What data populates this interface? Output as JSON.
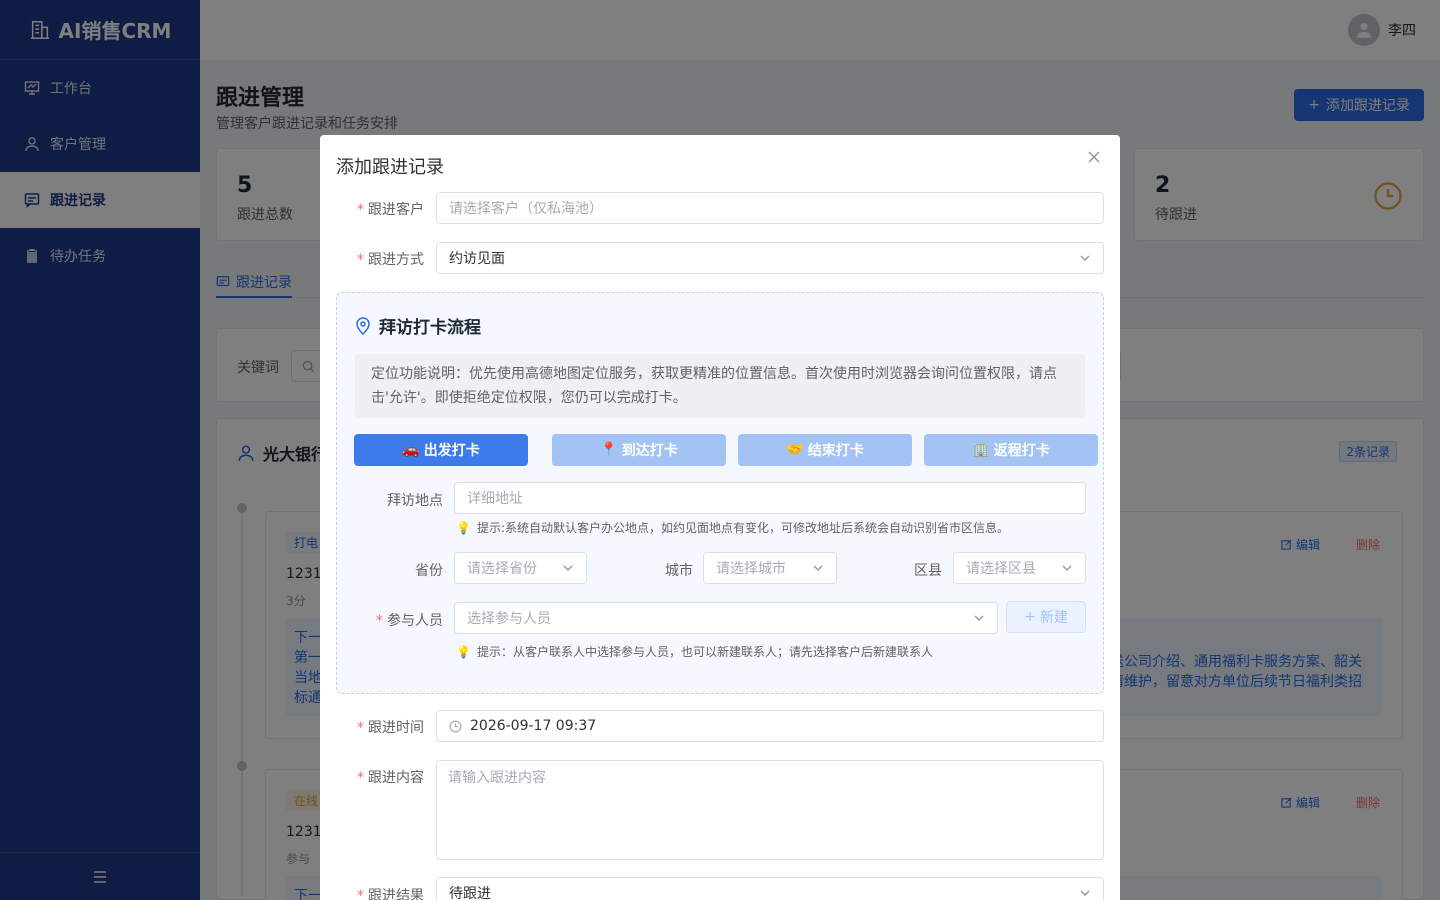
{
  "app": {
    "logo_text": "AI销售CRM"
  },
  "sidebar": {
    "items": [
      {
        "label": "工作台",
        "icon": "dashboard-icon"
      },
      {
        "label": "客户管理",
        "icon": "user-icon"
      },
      {
        "label": "跟进记录",
        "icon": "chat-icon",
        "active": true
      },
      {
        "label": "待办任务",
        "icon": "clipboard-icon"
      }
    ],
    "collapse_icon": "menu-collapse-icon"
  },
  "header": {
    "username": "李四"
  },
  "page": {
    "title": "跟进管理",
    "subtitle": "管理客户跟进记录和任务安排",
    "add_button": "添加跟进记录"
  },
  "stats": [
    {
      "value": "5",
      "label": "跟进总数"
    },
    {
      "value": "2",
      "label": "待跟进"
    }
  ],
  "tabs": [
    {
      "label": "跟进记录"
    }
  ],
  "filter": {
    "keyword_label": "关键词"
  },
  "group": {
    "title": "光大银行",
    "count_badge": "2条记录",
    "records": [
      {
        "tag": "打电",
        "title": "12312",
        "meta": "3分",
        "edit": "编辑",
        "delete": "删除",
        "next_label": "下一",
        "next_lines_left": [
          "第一",
          "当地",
          "标通"
        ],
        "next_lines_right": [
          "送公司介绍、通用福利卡服务方案、韶关",
          "情维护，留意对方单位后续节日福利类招"
        ]
      },
      {
        "tag": "在线",
        "title": "1231",
        "meta": "参与",
        "edit": "编辑",
        "delete": "删除",
        "next_label": "下一"
      }
    ]
  },
  "dialog": {
    "title": "添加跟进记录",
    "customer": {
      "label": "跟进客户",
      "placeholder": "请选择客户（仅私海池）"
    },
    "method": {
      "label": "跟进方式",
      "value": "约访见面"
    },
    "visit": {
      "title": "拜访打卡流程",
      "note": "定位功能说明：优先使用高德地图定位服务，获取更精准的位置信息。首次使用时浏览器会询问位置权限，请点击'允许'。即使拒绝定位权限，您仍可以完成打卡。",
      "buttons": [
        {
          "label": "出发打卡",
          "emoji": "🚗",
          "state": "primary"
        },
        {
          "label": "到达打卡",
          "emoji": "📍",
          "state": "disabled"
        },
        {
          "label": "结束打卡",
          "emoji": "🤝",
          "state": "disabled"
        },
        {
          "label": "返程打卡",
          "emoji": "🏢",
          "state": "disabled"
        }
      ],
      "address": {
        "label": "拜访地点",
        "placeholder": "详细地址"
      },
      "address_tip": "提示:系统自动默认客户办公地点，如约见面地点有变化，可修改地址后系统会自动识别省市区信息。",
      "province": {
        "label": "省份",
        "placeholder": "请选择省份"
      },
      "city": {
        "label": "城市",
        "placeholder": "请选择城市"
      },
      "district": {
        "label": "区县",
        "placeholder": "请选择区县"
      },
      "participants": {
        "label": "参与人员",
        "placeholder": "选择参与人员"
      },
      "new_button": "新建",
      "participants_tip": "提示：从客户联系人中选择参与人员，也可以新建联系人；请先选择客户后新建联系人"
    },
    "time": {
      "label": "跟进时间",
      "value": "2026-09-17 09:37"
    },
    "content": {
      "label": "跟进内容",
      "placeholder": "请输入跟进内容"
    },
    "result": {
      "label": "跟进结果",
      "value": "待跟进"
    }
  },
  "colors": {
    "sidebar_bg": "#1e3a8a",
    "primary": "#2b6de5",
    "danger": "#f56c6c",
    "warning": "#e6a23c"
  }
}
